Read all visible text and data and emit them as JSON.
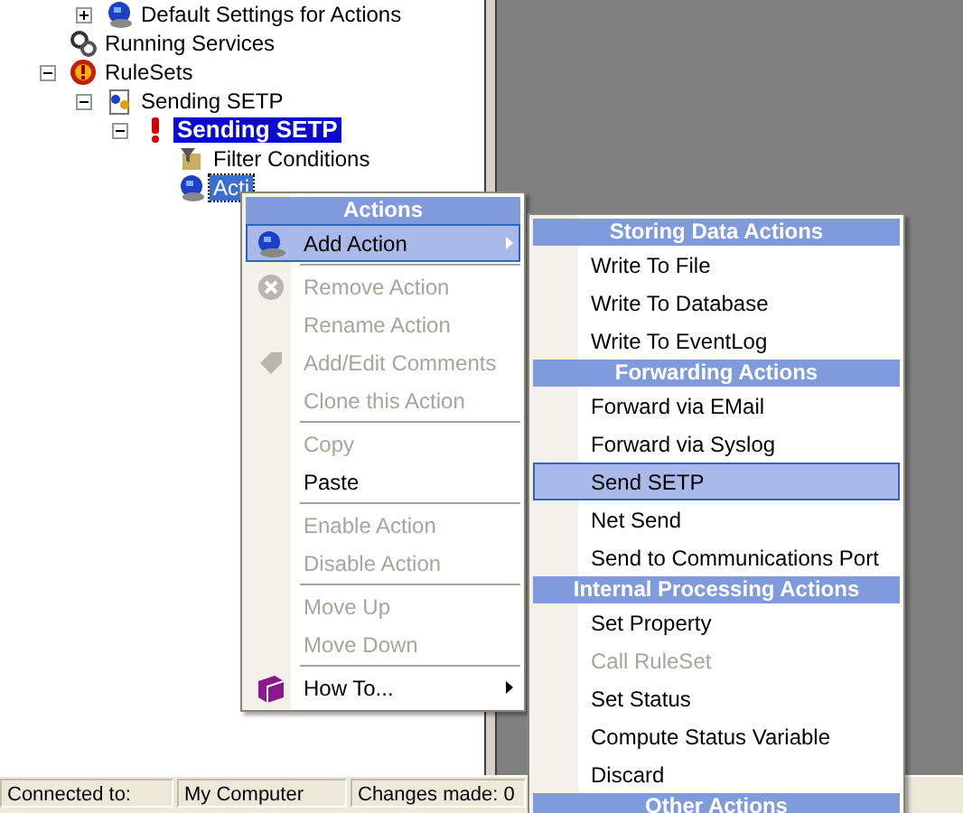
{
  "tree": [
    {
      "children": [
        {
          "label": "Default Settings for Actions",
          "kind": "settings",
          "expanded": false,
          "selected": false,
          "focused": false
        }
      ]
    },
    {
      "label": "Running Services",
      "kind": "services",
      "selected": false,
      "focused": false
    },
    {
      "label": "RuleSets",
      "kind": "rulesets",
      "expanded": true,
      "selected": false,
      "focused": false,
      "children": [
        {
          "label": "Sending SETP",
          "kind": "ruleset",
          "expanded": true,
          "selected": false,
          "focused": false,
          "children": [
            {
              "label": "Sending SETP",
              "kind": "rule",
              "expanded": true,
              "selected": true,
              "focused": false,
              "children": [
                {
                  "label": "Filter Conditions",
                  "kind": "filter",
                  "selected": false,
                  "focused": false
                },
                {
                  "label": "Acti",
                  "kind": "actions",
                  "selected": false,
                  "focused": true
                }
              ]
            }
          ]
        }
      ]
    }
  ],
  "context_menu": [
    {
      "kind": "header",
      "label": "Actions"
    },
    {
      "kind": "item",
      "label": "Add Action",
      "disabled": false,
      "selected": true,
      "submenu": true
    },
    {
      "kind": "separator"
    },
    {
      "kind": "item",
      "label": "Remove Action",
      "disabled": true,
      "selected": false,
      "submenu": false
    },
    {
      "kind": "item",
      "label": "Rename Action",
      "disabled": true,
      "selected": false,
      "submenu": false
    },
    {
      "kind": "item",
      "label": "Add/Edit Comments",
      "disabled": true,
      "selected": false,
      "submenu": false
    },
    {
      "kind": "item",
      "label": "Clone this Action",
      "disabled": true,
      "selected": false,
      "submenu": false
    },
    {
      "kind": "separator"
    },
    {
      "kind": "item",
      "label": "Copy",
      "disabled": true,
      "selected": false,
      "submenu": false
    },
    {
      "kind": "item",
      "label": "Paste",
      "disabled": false,
      "selected": false,
      "submenu": false
    },
    {
      "kind": "separator"
    },
    {
      "kind": "item",
      "label": "Enable Action",
      "disabled": true,
      "selected": false,
      "submenu": false
    },
    {
      "kind": "item",
      "label": "Disable Action",
      "disabled": true,
      "selected": false,
      "submenu": false
    },
    {
      "kind": "separator"
    },
    {
      "kind": "item",
      "label": "Move Up",
      "disabled": true,
      "selected": false,
      "submenu": false
    },
    {
      "kind": "item",
      "label": "Move Down",
      "disabled": true,
      "selected": false,
      "submenu": false
    },
    {
      "kind": "separator"
    },
    {
      "kind": "item",
      "label": "How To...",
      "disabled": false,
      "selected": false,
      "submenu": true
    }
  ],
  "submenu": [
    {
      "kind": "header",
      "label": "Storing Data Actions"
    },
    {
      "kind": "item",
      "label": "Write To File",
      "disabled": false,
      "selected": false
    },
    {
      "kind": "item",
      "label": "Write To Database",
      "disabled": false,
      "selected": false
    },
    {
      "kind": "item",
      "label": "Write To EventLog",
      "disabled": false,
      "selected": false
    },
    {
      "kind": "header",
      "label": "Forwarding Actions"
    },
    {
      "kind": "item",
      "label": "Forward via EMail",
      "disabled": false,
      "selected": false
    },
    {
      "kind": "item",
      "label": "Forward via Syslog",
      "disabled": false,
      "selected": false
    },
    {
      "kind": "item",
      "label": "Send SETP",
      "disabled": false,
      "selected": true
    },
    {
      "kind": "item",
      "label": "Net Send",
      "disabled": false,
      "selected": false
    },
    {
      "kind": "item",
      "label": "Send to Communications Port",
      "disabled": false,
      "selected": false
    },
    {
      "kind": "header",
      "label": "Internal Processing Actions"
    },
    {
      "kind": "item",
      "label": "Set Property",
      "disabled": false,
      "selected": false
    },
    {
      "kind": "item",
      "label": "Call RuleSet",
      "disabled": true,
      "selected": false
    },
    {
      "kind": "item",
      "label": "Set Status",
      "disabled": false,
      "selected": false
    },
    {
      "kind": "item",
      "label": "Compute Status Variable",
      "disabled": false,
      "selected": false
    },
    {
      "kind": "item",
      "label": "Discard",
      "disabled": false,
      "selected": false
    },
    {
      "kind": "header",
      "label": "Other Actions"
    }
  ],
  "status_bar": [
    "Connected to:",
    "My Computer",
    "Changes made: 0"
  ]
}
